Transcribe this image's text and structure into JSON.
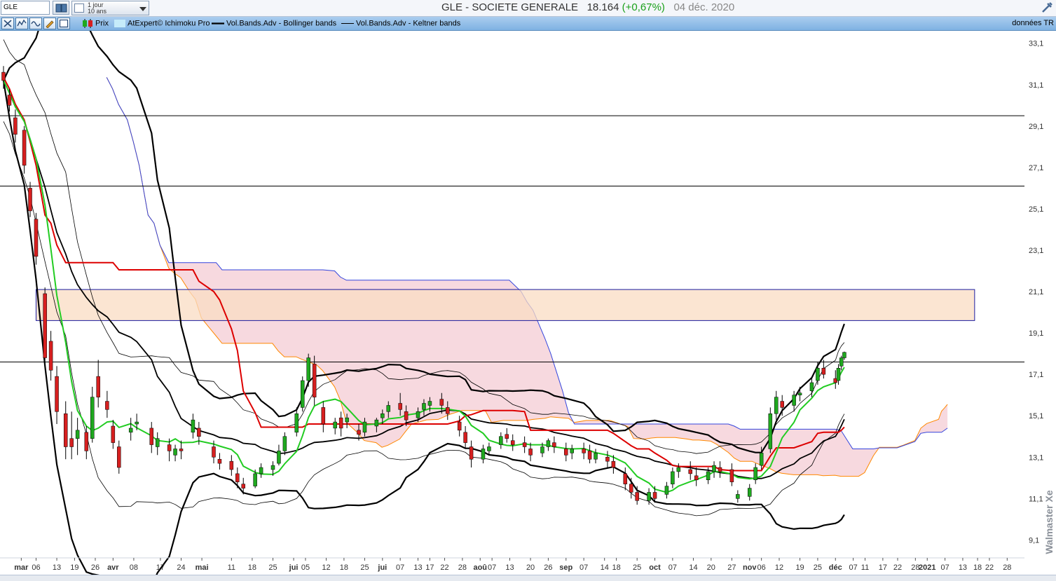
{
  "header": {
    "symbol": "GLE",
    "period_line1": "1 jour",
    "period_line2": "10 ans",
    "title": "GLE - SOCIETE GENERALE",
    "price": "18.164",
    "change": "(+0,67%)",
    "date": "04 déc. 2020"
  },
  "toolbar": {
    "legend": [
      "Prix",
      "AtExpert© Ichimoku Pro",
      "Vol.Bands.Adv - Bollinger bands",
      "Vol.Bands.Adv - Keltner bands"
    ],
    "data_source": "données TR"
  },
  "brand": "Walmaster Xe",
  "colors": {
    "up_candle": "#1fa81f",
    "down_candle": "#d61f1f",
    "tenkan": "#22cc22",
    "kijun": "#dd0000",
    "cloud_fill": "#f3c9d1",
    "kumo_upper": "#ff8800",
    "kumo_lower": "#3344dd",
    "future_kumo": "#c6ecfa",
    "zone_fill": "#f9dcc3",
    "zone_border": "#1a1aa0"
  },
  "chart_data": {
    "type": "candlestick",
    "y_axis": {
      "min": 8.3,
      "max": 33.7,
      "ticks": [
        "33,1",
        "31,1",
        "29,1",
        "27,1",
        "25,1",
        "23,1",
        "21,1",
        "19,1",
        "17,1",
        "15,1",
        "13,1",
        "11,1",
        "9,1"
      ]
    },
    "x_axis": {
      "start": "2020-02-24",
      "end": "2020-12-28",
      "tick_labels": [
        {
          "date": "2020-03-01",
          "label": "mar"
        },
        {
          "date": "2020-03-06",
          "label": "06"
        },
        {
          "date": "2020-03-13",
          "label": "13"
        },
        {
          "date": "2020-03-19",
          "label": "19"
        },
        {
          "date": "2020-03-26",
          "label": "26"
        },
        {
          "date": "2020-04-01",
          "label": "avr"
        },
        {
          "date": "2020-04-08",
          "label": "08"
        },
        {
          "date": "2020-04-17",
          "label": "17"
        },
        {
          "date": "2020-04-24",
          "label": "24"
        },
        {
          "date": "2020-05-01",
          "label": "mai"
        },
        {
          "date": "2020-05-11",
          "label": "11"
        },
        {
          "date": "2020-05-18",
          "label": "18"
        },
        {
          "date": "2020-05-25",
          "label": "25"
        },
        {
          "date": "2020-06-01",
          "label": "jui"
        },
        {
          "date": "2020-06-05",
          "label": "05"
        },
        {
          "date": "2020-06-12",
          "label": "12"
        },
        {
          "date": "2020-06-18",
          "label": "18"
        },
        {
          "date": "2020-06-25",
          "label": "25"
        },
        {
          "date": "2020-07-01",
          "label": "jui"
        },
        {
          "date": "2020-07-07",
          "label": "07"
        },
        {
          "date": "2020-07-13",
          "label": "13"
        },
        {
          "date": "2020-07-17",
          "label": "17"
        },
        {
          "date": "2020-07-22",
          "label": "22"
        },
        {
          "date": "2020-07-28",
          "label": "28"
        },
        {
          "date": "2020-08-03",
          "label": "aoû"
        },
        {
          "date": "2020-08-07",
          "label": "07"
        },
        {
          "date": "2020-08-13",
          "label": "13"
        },
        {
          "date": "2020-08-20",
          "label": "20"
        },
        {
          "date": "2020-08-26",
          "label": "26"
        },
        {
          "date": "2020-09-01",
          "label": "sep"
        },
        {
          "date": "2020-09-07",
          "label": "07"
        },
        {
          "date": "2020-09-14",
          "label": "14"
        },
        {
          "date": "2020-09-18",
          "label": "18"
        },
        {
          "date": "2020-09-25",
          "label": "25"
        },
        {
          "date": "2020-10-01",
          "label": "oct"
        },
        {
          "date": "2020-10-07",
          "label": "07"
        },
        {
          "date": "2020-10-14",
          "label": "14"
        },
        {
          "date": "2020-10-20",
          "label": "20"
        },
        {
          "date": "2020-10-27",
          "label": "27"
        },
        {
          "date": "2020-11-02",
          "label": "nov"
        },
        {
          "date": "2020-11-06",
          "label": "06"
        },
        {
          "date": "2020-11-12",
          "label": "12"
        },
        {
          "date": "2020-11-19",
          "label": "19"
        },
        {
          "date": "2020-11-25",
          "label": "25"
        },
        {
          "date": "2020-12-01",
          "label": "déc"
        },
        {
          "date": "2020-12-07",
          "label": "07"
        },
        {
          "date": "2020-12-11",
          "label": "11"
        },
        {
          "date": "2020-12-17",
          "label": "17"
        },
        {
          "date": "2020-12-22",
          "label": "22"
        },
        {
          "date": "2020-12-28",
          "label": "28"
        },
        {
          "date": "2021-01-01",
          "label": "2021"
        },
        {
          "date": "2021-01-07",
          "label": "07"
        },
        {
          "date": "2021-01-13",
          "label": "13"
        },
        {
          "date": "2021-01-18",
          "label": "18"
        },
        {
          "date": "2021-01-22",
          "label": "22"
        },
        {
          "date": "2021-01-28",
          "label": "28"
        }
      ]
    },
    "horizontal_lines": [
      29.6,
      26.2,
      17.7
    ],
    "zone": {
      "x_start": "2020-03-06",
      "x_end": "2021-01-17",
      "y_low": 19.7,
      "y_high": 21.2
    },
    "candles": [
      {
        "date": "2020-02-24",
        "o": 31.7,
        "h": 32.0,
        "c": 31.3,
        "l": 30.9
      },
      {
        "date": "2020-02-26",
        "o": 30.6,
        "h": 30.9,
        "c": 30.1,
        "l": 29.8
      },
      {
        "date": "2020-02-28",
        "o": 29.5,
        "h": 29.9,
        "c": 28.7,
        "l": 28.3
      },
      {
        "date": "2020-03-02",
        "o": 28.9,
        "h": 29.1,
        "c": 27.2,
        "l": 26.8
      },
      {
        "date": "2020-03-04",
        "o": 26.1,
        "h": 26.4,
        "c": 25.0,
        "l": 24.7
      },
      {
        "date": "2020-03-06",
        "o": 24.6,
        "h": 24.9,
        "c": 22.8,
        "l": 22.4
      },
      {
        "date": "2020-03-09",
        "o": 21.0,
        "h": 21.3,
        "c": 17.9,
        "l": 17.6
      },
      {
        "date": "2020-03-11",
        "o": 18.7,
        "h": 19.2,
        "c": 17.3,
        "l": 16.8
      },
      {
        "date": "2020-03-13",
        "o": 17.0,
        "h": 17.5,
        "c": 15.3,
        "l": 14.7
      },
      {
        "date": "2020-03-16",
        "o": 15.2,
        "h": 15.8,
        "c": 13.6,
        "l": 13.0
      },
      {
        "date": "2020-03-18",
        "o": 14.0,
        "h": 15.3,
        "c": 13.6,
        "l": 13.0
      },
      {
        "date": "2020-03-20",
        "o": 14.0,
        "h": 15.0,
        "c": 14.4,
        "l": 13.2
      },
      {
        "date": "2020-03-23",
        "o": 14.3,
        "h": 14.6,
        "c": 13.4,
        "l": 13.0
      },
      {
        "date": "2020-03-25",
        "o": 14.0,
        "h": 16.5,
        "c": 16.0,
        "l": 13.8
      },
      {
        "date": "2020-03-27",
        "o": 17.0,
        "h": 17.8,
        "c": 16.0,
        "l": 15.5
      },
      {
        "date": "2020-03-30",
        "o": 15.8,
        "h": 16.3,
        "c": 15.4,
        "l": 15.0
      },
      {
        "date": "2020-04-01",
        "o": 14.6,
        "h": 14.9,
        "c": 13.8,
        "l": 13.5
      },
      {
        "date": "2020-04-03",
        "o": 13.6,
        "h": 13.9,
        "c": 12.6,
        "l": 12.3
      },
      {
        "date": "2020-04-07",
        "o": 14.3,
        "h": 15.0,
        "c": 14.5,
        "l": 13.9
      },
      {
        "date": "2020-04-09",
        "o": 14.7,
        "h": 15.2,
        "c": 14.8,
        "l": 14.4
      },
      {
        "date": "2020-04-14",
        "o": 14.5,
        "h": 14.8,
        "c": 13.7,
        "l": 13.3
      },
      {
        "date": "2020-04-16",
        "o": 13.6,
        "h": 14.3,
        "c": 14.0,
        "l": 13.2
      },
      {
        "date": "2020-04-20",
        "o": 13.7,
        "h": 14.0,
        "c": 13.4,
        "l": 12.9
      },
      {
        "date": "2020-04-22",
        "o": 13.2,
        "h": 13.7,
        "c": 13.5,
        "l": 12.9
      },
      {
        "date": "2020-04-24",
        "o": 13.5,
        "h": 13.9,
        "c": 13.4,
        "l": 13.0
      },
      {
        "date": "2020-04-28",
        "o": 14.3,
        "h": 15.2,
        "c": 14.9,
        "l": 14.0
      },
      {
        "date": "2020-04-30",
        "o": 14.5,
        "h": 14.8,
        "c": 14.1,
        "l": 13.7
      },
      {
        "date": "2020-05-05",
        "o": 13.6,
        "h": 13.9,
        "c": 13.1,
        "l": 12.8
      },
      {
        "date": "2020-05-07",
        "o": 13.0,
        "h": 13.3,
        "c": 12.8,
        "l": 12.5
      },
      {
        "date": "2020-05-11",
        "o": 12.9,
        "h": 13.2,
        "c": 12.5,
        "l": 12.2
      },
      {
        "date": "2020-05-13",
        "o": 12.3,
        "h": 12.6,
        "c": 11.9,
        "l": 11.6
      },
      {
        "date": "2020-05-15",
        "o": 11.8,
        "h": 12.1,
        "c": 11.6,
        "l": 11.3
      },
      {
        "date": "2020-05-19",
        "o": 11.7,
        "h": 12.5,
        "c": 12.3,
        "l": 11.6
      },
      {
        "date": "2020-05-21",
        "o": 12.3,
        "h": 12.8,
        "c": 12.6,
        "l": 12.1
      },
      {
        "date": "2020-05-25",
        "o": 12.5,
        "h": 12.9,
        "c": 12.7,
        "l": 12.2
      },
      {
        "date": "2020-05-27",
        "o": 12.8,
        "h": 13.7,
        "c": 13.4,
        "l": 12.7
      },
      {
        "date": "2020-05-29",
        "o": 13.4,
        "h": 14.3,
        "c": 14.1,
        "l": 13.2
      },
      {
        "date": "2020-06-02",
        "o": 14.3,
        "h": 15.5,
        "c": 15.2,
        "l": 14.1
      },
      {
        "date": "2020-06-04",
        "o": 15.5,
        "h": 17.0,
        "c": 16.8,
        "l": 15.3
      },
      {
        "date": "2020-06-06",
        "o": 16.8,
        "h": 18.1,
        "c": 17.9,
        "l": 16.5
      },
      {
        "date": "2020-06-08",
        "o": 17.6,
        "h": 18.0,
        "c": 16.0,
        "l": 15.6
      },
      {
        "date": "2020-06-11",
        "o": 15.5,
        "h": 15.8,
        "c": 14.7,
        "l": 14.3
      },
      {
        "date": "2020-06-15",
        "o": 14.5,
        "h": 15.0,
        "c": 14.8,
        "l": 14.2
      },
      {
        "date": "2020-06-17",
        "o": 15.0,
        "h": 15.3,
        "c": 14.5,
        "l": 14.1
      },
      {
        "date": "2020-06-19",
        "o": 14.8,
        "h": 15.2,
        "c": 15.0,
        "l": 14.5
      },
      {
        "date": "2020-06-23",
        "o": 14.4,
        "h": 14.7,
        "c": 14.2,
        "l": 13.9
      },
      {
        "date": "2020-06-25",
        "o": 14.3,
        "h": 15.0,
        "c": 14.8,
        "l": 14.1
      },
      {
        "date": "2020-06-29",
        "o": 14.6,
        "h": 15.0,
        "c": 14.9,
        "l": 14.3
      },
      {
        "date": "2020-07-01",
        "o": 15.0,
        "h": 15.4,
        "c": 15.2,
        "l": 14.7
      },
      {
        "date": "2020-07-03",
        "o": 15.3,
        "h": 15.8,
        "c": 15.6,
        "l": 15.0
      },
      {
        "date": "2020-07-07",
        "o": 15.7,
        "h": 16.2,
        "c": 15.4,
        "l": 15.1
      },
      {
        "date": "2020-07-09",
        "o": 15.3,
        "h": 15.6,
        "c": 14.9,
        "l": 14.6
      },
      {
        "date": "2020-07-13",
        "o": 15.0,
        "h": 15.5,
        "c": 15.3,
        "l": 14.8
      },
      {
        "date": "2020-07-15",
        "o": 15.4,
        "h": 15.9,
        "c": 15.7,
        "l": 15.1
      },
      {
        "date": "2020-07-17",
        "o": 15.6,
        "h": 16.0,
        "c": 15.8,
        "l": 15.3
      },
      {
        "date": "2020-07-21",
        "o": 15.9,
        "h": 16.2,
        "c": 15.6,
        "l": 15.2
      },
      {
        "date": "2020-07-23",
        "o": 15.5,
        "h": 15.8,
        "c": 15.2,
        "l": 14.9
      },
      {
        "date": "2020-07-27",
        "o": 14.8,
        "h": 15.1,
        "c": 14.4,
        "l": 14.1
      },
      {
        "date": "2020-07-29",
        "o": 14.3,
        "h": 14.6,
        "c": 13.8,
        "l": 13.5
      },
      {
        "date": "2020-07-31",
        "o": 13.6,
        "h": 13.9,
        "c": 13.0,
        "l": 12.6
      },
      {
        "date": "2020-08-04",
        "o": 13.0,
        "h": 13.7,
        "c": 13.5,
        "l": 12.8
      },
      {
        "date": "2020-08-06",
        "o": 13.4,
        "h": 13.8,
        "c": 13.6,
        "l": 13.2
      },
      {
        "date": "2020-08-10",
        "o": 13.7,
        "h": 14.3,
        "c": 14.1,
        "l": 13.5
      },
      {
        "date": "2020-08-12",
        "o": 14.2,
        "h": 14.5,
        "c": 14.0,
        "l": 13.8
      },
      {
        "date": "2020-08-14",
        "o": 13.9,
        "h": 14.2,
        "c": 13.7,
        "l": 13.4
      },
      {
        "date": "2020-08-18",
        "o": 13.8,
        "h": 14.1,
        "c": 13.6,
        "l": 13.3
      },
      {
        "date": "2020-08-20",
        "o": 13.5,
        "h": 13.8,
        "c": 13.2,
        "l": 12.9
      },
      {
        "date": "2020-08-24",
        "o": 13.3,
        "h": 13.8,
        "c": 13.6,
        "l": 13.1
      },
      {
        "date": "2020-08-26",
        "o": 13.6,
        "h": 14.0,
        "c": 13.9,
        "l": 13.4
      },
      {
        "date": "2020-08-28",
        "o": 13.8,
        "h": 14.1,
        "c": 13.6,
        "l": 13.3
      },
      {
        "date": "2020-09-01",
        "o": 13.5,
        "h": 13.8,
        "c": 13.2,
        "l": 12.9
      },
      {
        "date": "2020-09-03",
        "o": 13.3,
        "h": 13.7,
        "c": 13.5,
        "l": 13.0
      },
      {
        "date": "2020-09-07",
        "o": 13.5,
        "h": 13.8,
        "c": 13.3,
        "l": 13.0
      },
      {
        "date": "2020-09-09",
        "o": 13.4,
        "h": 13.7,
        "c": 13.0,
        "l": 12.8
      },
      {
        "date": "2020-09-11",
        "o": 13.0,
        "h": 13.5,
        "c": 13.3,
        "l": 12.8
      },
      {
        "date": "2020-09-15",
        "o": 13.1,
        "h": 13.4,
        "c": 12.9,
        "l": 12.6
      },
      {
        "date": "2020-09-17",
        "o": 12.9,
        "h": 13.2,
        "c": 12.6,
        "l": 12.3
      },
      {
        "date": "2020-09-21",
        "o": 12.3,
        "h": 12.6,
        "c": 11.8,
        "l": 11.5
      },
      {
        "date": "2020-09-23",
        "o": 11.8,
        "h": 12.1,
        "c": 11.4,
        "l": 11.1
      },
      {
        "date": "2020-09-25",
        "o": 11.4,
        "h": 11.7,
        "c": 11.0,
        "l": 10.8
      },
      {
        "date": "2020-09-29",
        "o": 11.0,
        "h": 11.6,
        "c": 11.4,
        "l": 10.8
      },
      {
        "date": "2020-10-01",
        "o": 11.4,
        "h": 11.7,
        "c": 11.1,
        "l": 10.9
      },
      {
        "date": "2020-10-05",
        "o": 11.3,
        "h": 11.9,
        "c": 11.7,
        "l": 11.1
      },
      {
        "date": "2020-10-07",
        "o": 11.8,
        "h": 12.6,
        "c": 12.4,
        "l": 11.6
      },
      {
        "date": "2020-10-09",
        "o": 12.4,
        "h": 12.8,
        "c": 12.6,
        "l": 12.1
      },
      {
        "date": "2020-10-13",
        "o": 12.5,
        "h": 12.9,
        "c": 12.3,
        "l": 12.0
      },
      {
        "date": "2020-10-15",
        "o": 12.2,
        "h": 12.6,
        "c": 12.0,
        "l": 11.7
      },
      {
        "date": "2020-10-19",
        "o": 12.0,
        "h": 12.6,
        "c": 12.4,
        "l": 11.8
      },
      {
        "date": "2020-10-21",
        "o": 12.4,
        "h": 12.9,
        "c": 12.7,
        "l": 12.1
      },
      {
        "date": "2020-10-23",
        "o": 12.6,
        "h": 12.9,
        "c": 12.4,
        "l": 12.1
      },
      {
        "date": "2020-10-27",
        "o": 12.5,
        "h": 12.8,
        "c": 11.9,
        "l": 11.7
      },
      {
        "date": "2020-10-29",
        "o": 11.1,
        "h": 11.5,
        "c": 11.3,
        "l": 10.9
      },
      {
        "date": "2020-11-02",
        "o": 11.2,
        "h": 11.8,
        "c": 11.6,
        "l": 11.0
      },
      {
        "date": "2020-11-04",
        "o": 12.0,
        "h": 12.8,
        "c": 12.6,
        "l": 11.8
      },
      {
        "date": "2020-11-06",
        "o": 12.7,
        "h": 13.6,
        "c": 13.3,
        "l": 12.5
      },
      {
        "date": "2020-11-09",
        "o": 13.5,
        "h": 15.5,
        "c": 15.2,
        "l": 13.3
      },
      {
        "date": "2020-11-11",
        "o": 15.2,
        "h": 16.3,
        "c": 16.0,
        "l": 14.9
      },
      {
        "date": "2020-11-13",
        "o": 15.8,
        "h": 16.1,
        "c": 15.5,
        "l": 15.1
      },
      {
        "date": "2020-11-17",
        "o": 15.6,
        "h": 16.3,
        "c": 16.1,
        "l": 15.3
      },
      {
        "date": "2020-11-19",
        "o": 16.1,
        "h": 16.5,
        "c": 16.2,
        "l": 15.8
      },
      {
        "date": "2020-11-23",
        "o": 16.3,
        "h": 16.9,
        "c": 16.7,
        "l": 16.0
      },
      {
        "date": "2020-11-25",
        "o": 16.8,
        "h": 17.7,
        "c": 17.4,
        "l": 16.6
      },
      {
        "date": "2020-11-27",
        "o": 17.4,
        "h": 17.8,
        "c": 17.1,
        "l": 16.9
      },
      {
        "date": "2020-12-01",
        "o": 16.9,
        "h": 17.3,
        "c": 16.7,
        "l": 16.4
      },
      {
        "date": "2020-12-02",
        "o": 16.8,
        "h": 17.6,
        "c": 17.4,
        "l": 16.6
      },
      {
        "date": "2020-12-03",
        "o": 17.5,
        "h": 18.0,
        "c": 17.9,
        "l": 17.3
      },
      {
        "date": "2020-12-04",
        "o": 17.9,
        "h": 18.2,
        "c": 18.164,
        "l": 17.8
      }
    ]
  }
}
